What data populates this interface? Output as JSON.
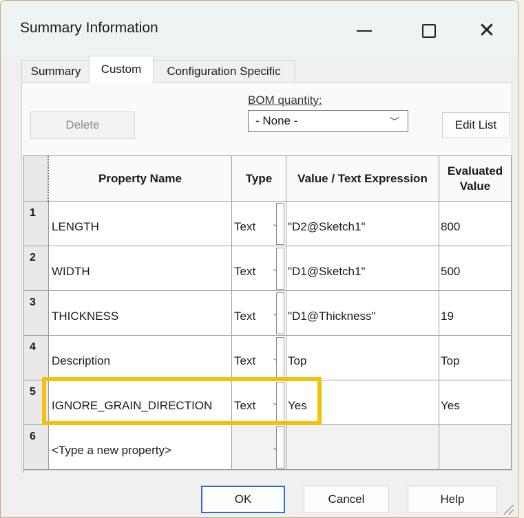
{
  "window": {
    "title": "Summary Information",
    "controls": {
      "minimize": "—",
      "maximize": "",
      "close": "✕"
    }
  },
  "tabs": [
    {
      "label": "Summary",
      "selected": false
    },
    {
      "label": "Custom",
      "selected": true
    },
    {
      "label": "Configuration Specific",
      "selected": false
    }
  ],
  "toolbar": {
    "delete_label": "Delete",
    "bom_label": "BOM quantity:",
    "bom_value": "- None -",
    "edit_list_label": "Edit List"
  },
  "table": {
    "headers": {
      "name": "Property Name",
      "type": "Type",
      "value": "Value / Text Expression",
      "evaluated_line1": "Evaluated",
      "evaluated_line2": "Value"
    },
    "rows": [
      {
        "num": "1",
        "name": "LENGTH",
        "type": "Text",
        "value": "\"D2@Sketch1\"",
        "evaluated": "800"
      },
      {
        "num": "2",
        "name": "WIDTH",
        "type": "Text",
        "value": "\"D1@Sketch1\"",
        "evaluated": "500"
      },
      {
        "num": "3",
        "name": "THICKNESS",
        "type": "Text",
        "value": "\"D1@Thickness\"",
        "evaluated": "19"
      },
      {
        "num": "4",
        "name": "Description",
        "type": "Text",
        "value": "Top",
        "evaluated": "Top"
      },
      {
        "num": "5",
        "name": "IGNORE_GRAIN_DIRECTION",
        "type": "Text",
        "value": "Yes",
        "evaluated": "Yes"
      },
      {
        "num": "6",
        "name": "<Type a new property>",
        "type": "",
        "value": "",
        "evaluated": ""
      }
    ]
  },
  "highlight_color": "#f2c108",
  "footer": {
    "ok_label": "OK",
    "cancel_label": "Cancel",
    "help_label": "Help"
  }
}
